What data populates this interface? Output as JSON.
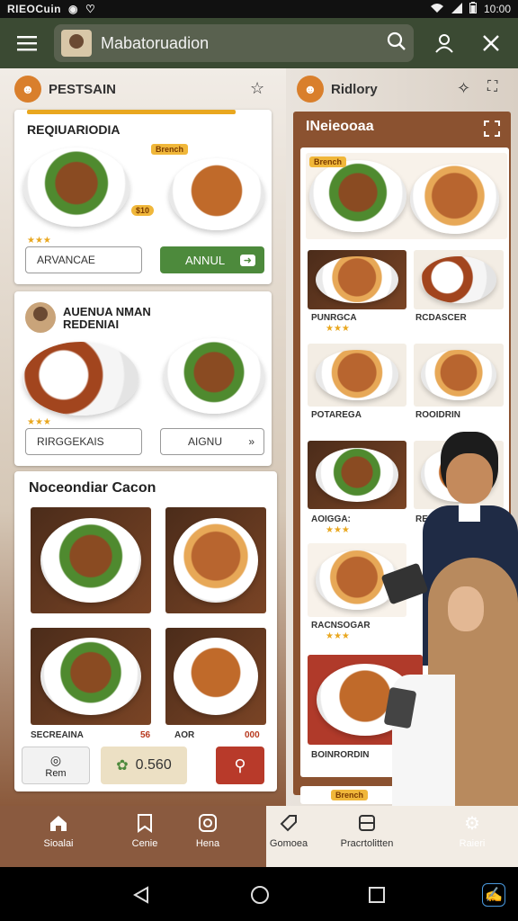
{
  "status_bar": {
    "carrier": "RIEOCuin",
    "time": "10:00"
  },
  "app_bar": {
    "search_text": "Mabatoruadion"
  },
  "left_panel": {
    "header": "PESTSAIN",
    "card1": {
      "title": "REQIUARIODIA",
      "tag1": "Brench",
      "tag2": "$10",
      "button_left": "ARVANCAE",
      "button_right": "ANNUL"
    },
    "card2": {
      "title_line1": "AUENUA NMAN",
      "title_line2": "REDENIAI",
      "button_left": "RIRGGEKAIS",
      "button_right": "AIGNU"
    },
    "card3": {
      "title": "Noceondiar Cacon",
      "price_left": "SECREAINA",
      "price_left_num": "56",
      "price_right": "AOR",
      "price_right_num": "000"
    },
    "actions": {
      "left_label": "Rem",
      "mid_label": "0.560"
    }
  },
  "right_panel": {
    "header": "Ridlory",
    "section_title": "INeieooaa",
    "items": [
      {
        "name": "PUNRGCA"
      },
      {
        "name": "RCDASCER"
      },
      {
        "name": "POTAREGA"
      },
      {
        "name": "ROOIDRIN"
      },
      {
        "name": "AOIGGA:"
      },
      {
        "name": "RESUT"
      },
      {
        "name": "RACNSOGAR"
      },
      {
        "name": "BOINRORDIN"
      }
    ],
    "tag": "Brench"
  },
  "bottom_nav": {
    "items": [
      {
        "label": "Sioalai",
        "icon": "home-icon"
      },
      {
        "label": "Cenie",
        "icon": "bookmark-icon"
      },
      {
        "label": "Hena",
        "icon": "instagram-icon"
      },
      {
        "label": "Gomoea",
        "icon": "tag-icon"
      },
      {
        "label": "Pracrtolitten",
        "icon": "storage-icon"
      },
      {
        "label": "Raieri",
        "icon": "gear-icon"
      }
    ]
  },
  "colors": {
    "appbar": "#3b4a33",
    "accent_orange": "#e9a71f",
    "green_button": "#4d8a3c",
    "red_button": "#b83a2a",
    "nav_brown": "#8a5a3f"
  }
}
